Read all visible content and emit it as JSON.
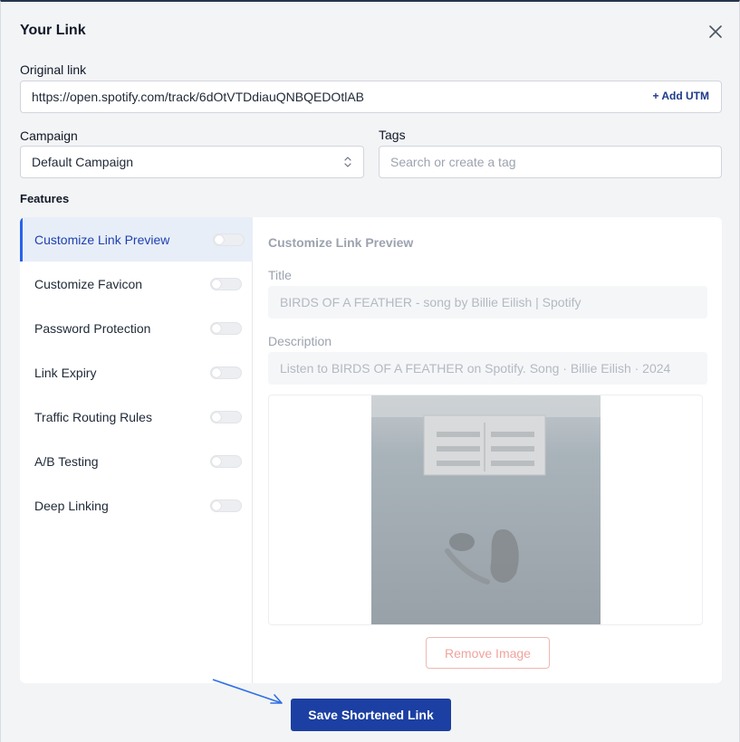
{
  "dialog": {
    "title": "Your Link"
  },
  "original_link": {
    "label": "Original link",
    "value": "https://open.spotify.com/track/6dOtVTDdiauQNBQEDOtlAB",
    "add_utm": "+ Add UTM"
  },
  "campaign": {
    "label": "Campaign",
    "value": "Default Campaign"
  },
  "tags": {
    "label": "Tags",
    "placeholder": "Search or create a tag"
  },
  "features": {
    "label": "Features",
    "items": [
      {
        "label": "Customize Link Preview",
        "active": true,
        "enabled": false
      },
      {
        "label": "Customize Favicon",
        "active": false,
        "enabled": false
      },
      {
        "label": "Password Protection",
        "active": false,
        "enabled": false
      },
      {
        "label": "Link Expiry",
        "active": false,
        "enabled": false
      },
      {
        "label": "Traffic Routing Rules",
        "active": false,
        "enabled": false
      },
      {
        "label": "A/B Testing",
        "active": false,
        "enabled": false
      },
      {
        "label": "Deep Linking",
        "active": false,
        "enabled": false
      }
    ]
  },
  "preview": {
    "heading": "Customize Link Preview",
    "title_label": "Title",
    "title_value": "BIRDS OF A FEATHER - song by Billie Eilish | Spotify",
    "description_label": "Description",
    "description_value": "Listen to BIRDS OF A FEATHER on Spotify. Song · Billie Eilish · 2024",
    "remove_image": "Remove Image"
  },
  "actions": {
    "save": "Save Shortened Link"
  },
  "colors": {
    "primary": "#1c3fa3",
    "active_feature": "#2563eb",
    "danger_soft": "#f0a49d",
    "annotation_arrow": "#2f6fe4"
  },
  "icons": {
    "close": "close-icon",
    "select": "chevron-updown-icon",
    "annotation": "arrow-annotation-icon"
  }
}
